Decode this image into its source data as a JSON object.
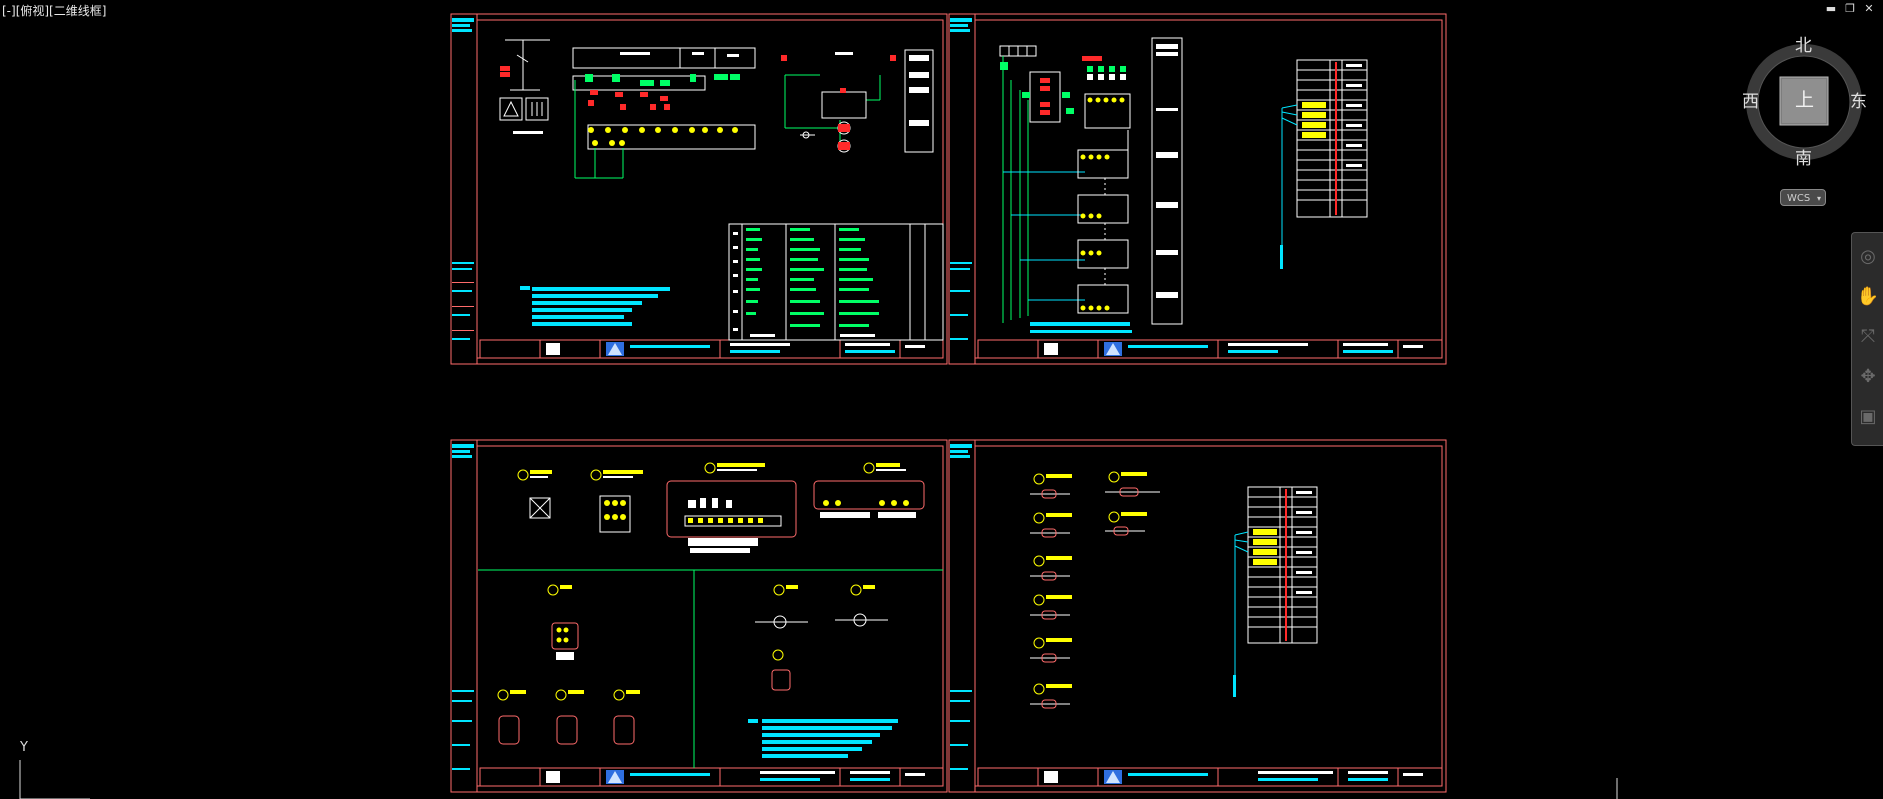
{
  "viewport": {
    "label": "[-][俯视][二维线框]"
  },
  "window_controls": {
    "minimize": "▬",
    "restore": "❐",
    "close": "✕"
  },
  "viewcube": {
    "north": "北",
    "south": "南",
    "east": "东",
    "west": "西",
    "face": "上"
  },
  "wcs": {
    "label": "WCS",
    "arrow": "▾"
  },
  "navbar": {
    "tools": [
      {
        "name": "steering-wheel-icon",
        "glyph": "◎"
      },
      {
        "name": "pan-hand-icon",
        "glyph": "✋"
      },
      {
        "name": "zoom-extents-icon",
        "glyph": "⤧"
      },
      {
        "name": "orbit-icon",
        "glyph": "✥"
      },
      {
        "name": "showmotion-icon",
        "glyph": "▣"
      }
    ]
  },
  "ucs": {
    "y_label": "Y"
  },
  "colors": {
    "sheet_frame": "#ff6b6b",
    "wire_green": "#00ff66",
    "text_cyan": "#00e5ff",
    "text_yellow": "#ffff00",
    "text_white": "#ffffff",
    "marker_red": "#ff2a2a",
    "logo_blue": "#2f6fe0"
  }
}
